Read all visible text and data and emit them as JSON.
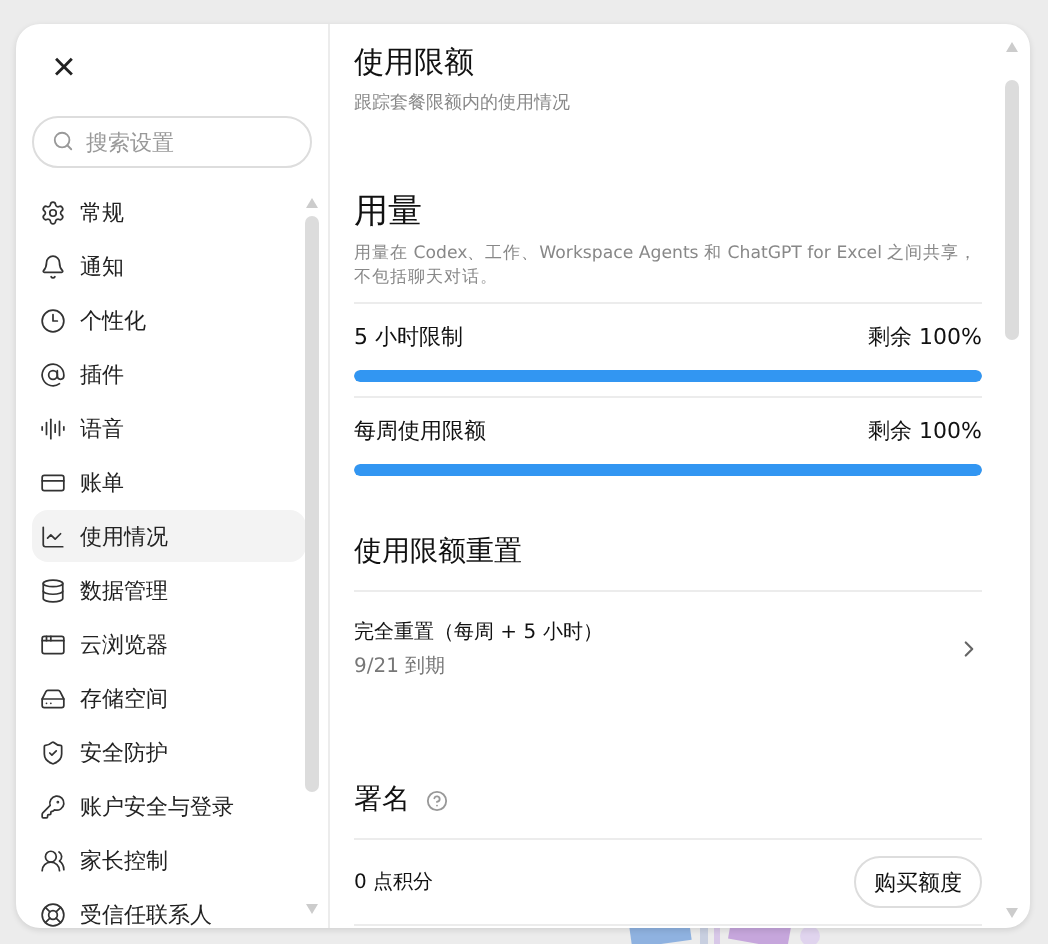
{
  "close_button": {
    "label": "×"
  },
  "search": {
    "placeholder": "搜索设置"
  },
  "sidebar": {
    "items": [
      {
        "label": "常规",
        "selected": false
      },
      {
        "label": "通知",
        "selected": false
      },
      {
        "label": "个性化",
        "selected": false
      },
      {
        "label": "插件",
        "selected": false
      },
      {
        "label": "语音",
        "selected": false
      },
      {
        "label": "账单",
        "selected": false
      },
      {
        "label": "使用情况",
        "selected": true
      },
      {
        "label": "数据管理",
        "selected": false
      },
      {
        "label": "云浏览器",
        "selected": false
      },
      {
        "label": "存储空间",
        "selected": false
      },
      {
        "label": "安全防护",
        "selected": false
      },
      {
        "label": "账户安全与登录",
        "selected": false
      },
      {
        "label": "家长控制",
        "selected": false
      },
      {
        "label": "受信任联系人",
        "selected": false
      }
    ]
  },
  "header": {
    "title": "使用限额",
    "subtitle": "跟踪套餐限额内的使用情况"
  },
  "usage": {
    "title": "用量",
    "description": "用量在 Codex、工作、Workspace Agents 和 ChatGPT for Excel 之间共享，不包括聊天对话。",
    "meters": [
      {
        "label": "5 小时限制",
        "reading": "剩余 100%",
        "level": 1
      },
      {
        "label": "每周使用限额",
        "reading": "剩余 100%",
        "level": 1
      }
    ]
  },
  "reset": {
    "title": "使用限额重置",
    "items": [
      {
        "label": "完全重置（每周 + 5 小时）",
        "detail": "9/21 到期"
      }
    ]
  },
  "credits": {
    "title": "署名",
    "balance": "0 点积分",
    "button": "购买额度"
  }
}
